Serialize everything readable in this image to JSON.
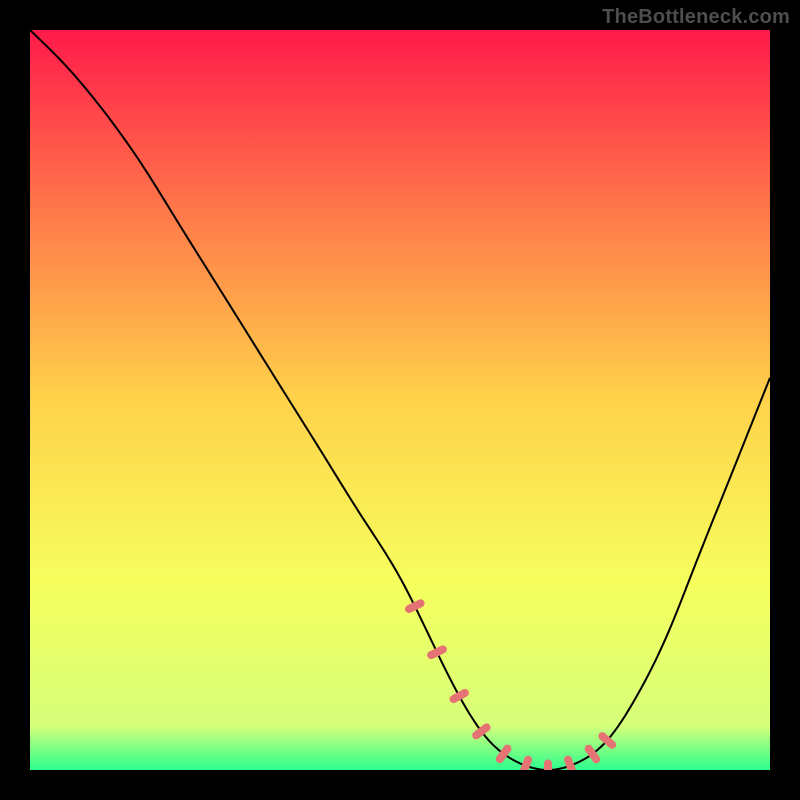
{
  "watermark": "TheBottleneck.com",
  "colors": {
    "dash": "#e57373"
  },
  "chart_data": {
    "type": "line",
    "title": "",
    "xlabel": "",
    "ylabel": "",
    "xlim": [
      0,
      100
    ],
    "ylim": [
      0,
      100
    ],
    "gradient_stops": [
      {
        "offset": 0,
        "color": "#ff1a4a"
      },
      {
        "offset": 25,
        "color": "#ff7a4a"
      },
      {
        "offset": 50,
        "color": "#ffd24a"
      },
      {
        "offset": 75,
        "color": "#f6ff5e"
      },
      {
        "offset": 94,
        "color": "#d6ff7a"
      },
      {
        "offset": 100,
        "color": "#2cff8e"
      }
    ],
    "series": [
      {
        "name": "bottleneck-curve",
        "x": [
          0,
          5,
          10,
          15,
          20,
          25,
          30,
          35,
          40,
          45,
          50,
          54,
          58,
          62,
          66,
          70,
          74,
          78,
          82,
          86,
          90,
          94,
          98,
          100
        ],
        "values": [
          100,
          95,
          89,
          82,
          74,
          66,
          58,
          50,
          42,
          34,
          26,
          18,
          10,
          4,
          1,
          0,
          1,
          4,
          10,
          18,
          28,
          38,
          48,
          53
        ]
      }
    ],
    "dashes_x": [
      52,
      55,
      58,
      61,
      64,
      67,
      70,
      73,
      76,
      78
    ]
  }
}
